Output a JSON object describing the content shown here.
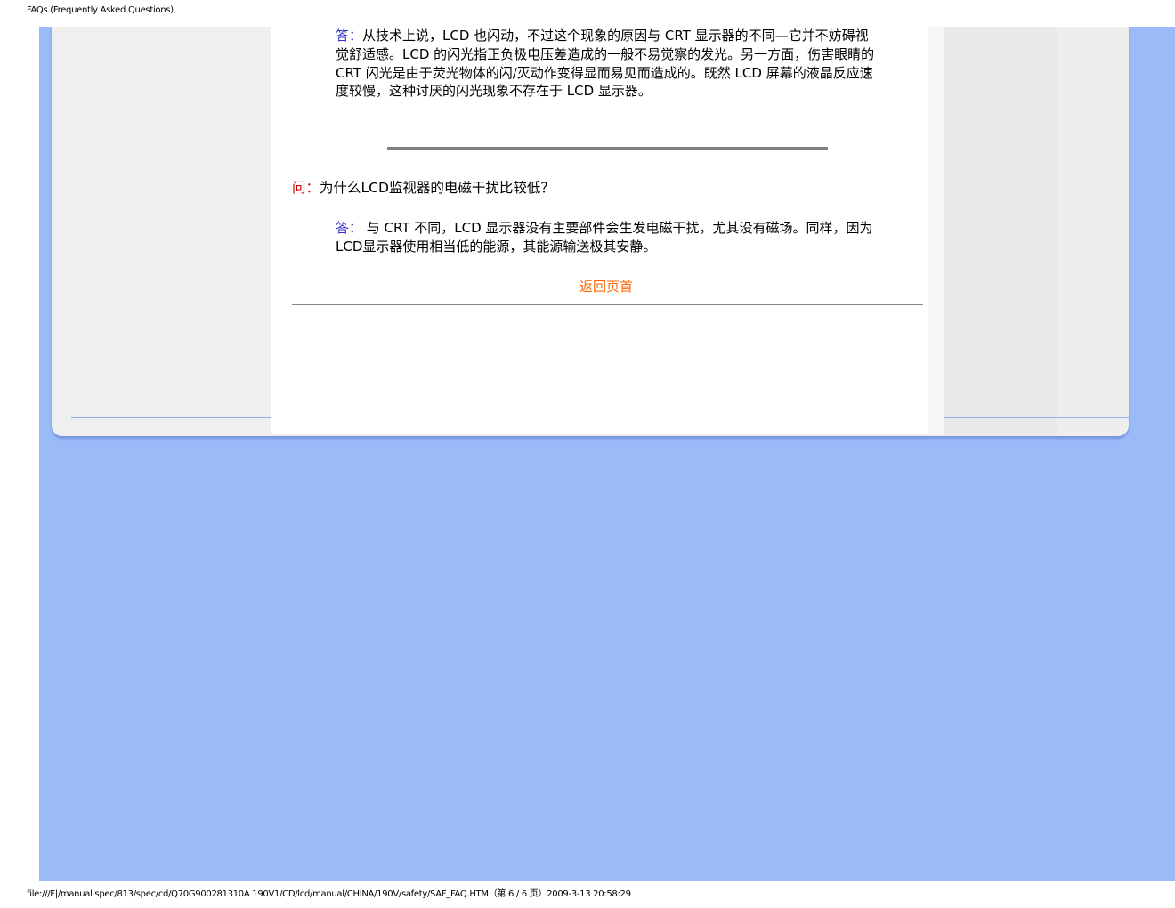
{
  "header": {
    "title": "FAQs (Frequently Asked Questions)"
  },
  "content": {
    "answer1": {
      "label": "答：",
      "text": "从技术上说，LCD 也闪动，不过这个现象的原因与 CRT 显示器的不同—它并不妨碍视觉舒适感。LCD 的闪光指正负极电压差造成的一般不易觉察的发光。另一方面，伤害眼睛的 CRT 闪光是由于荧光物体的闪/灭动作变得显而易见而造成的。既然 LCD 屏幕的液晶反应速度较慢，这种讨厌的闪光现象不存在于 LCD 显示器。"
    },
    "question2": {
      "label": "问：",
      "text": "为什么LCD监视器的电磁干扰比较低？"
    },
    "answer2": {
      "label": "答：",
      "text": " 与 CRT 不同，LCD 显示器没有主要部件会生发电磁干扰，尤其没有磁场。同样，因为LCD显示器使用相当低的能源，其能源输送极其安静。"
    },
    "back_to_top": "返回页首"
  },
  "footer": {
    "path": "file:///F|/manual spec/813/spec/cd/Q70G900281310A 190V1/CD/lcd/manual/CHINA/190V/safety/SAF_FAQ.HTM（第 6 / 6 页）2009-3-13 20:58:29"
  },
  "colors": {
    "background_blue": "#9abbf8",
    "answer_label": "#3333cc",
    "question_label": "#cc0000",
    "link": "#ff6600"
  }
}
